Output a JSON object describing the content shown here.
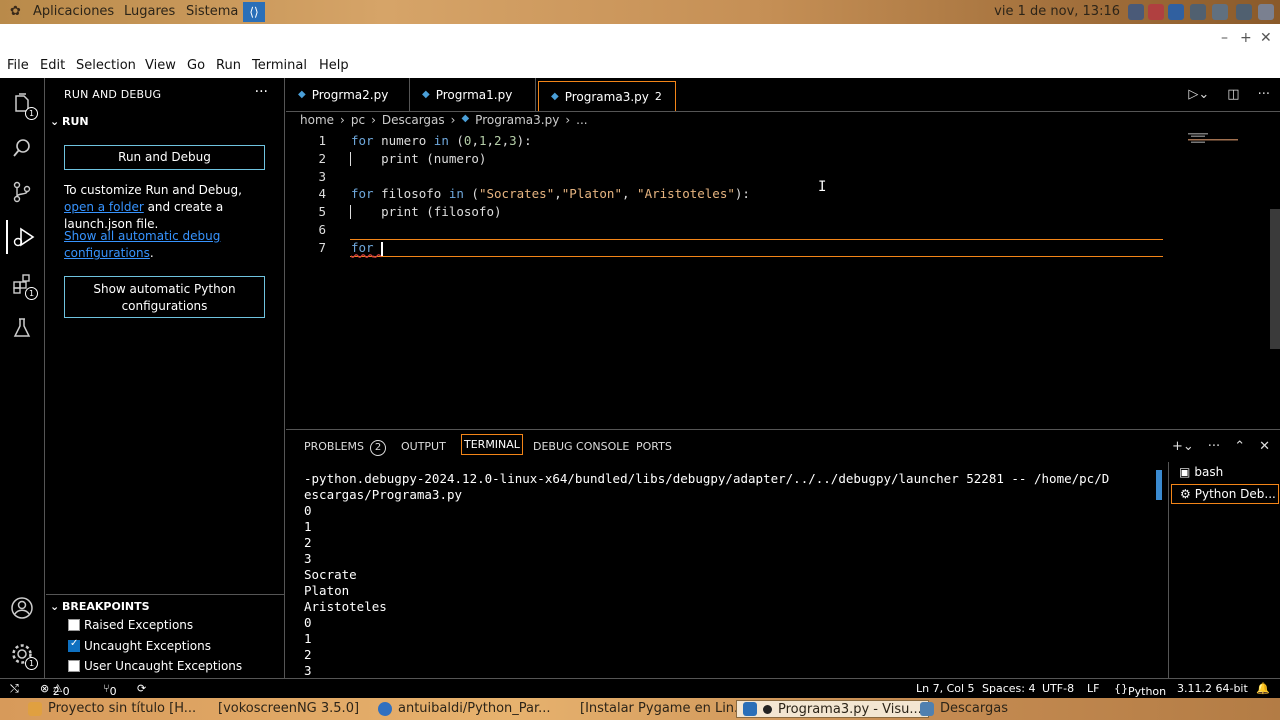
{
  "os_panel": {
    "menus": [
      "Aplicaciones",
      "Lugares",
      "Sistema"
    ],
    "clock": "vie  1 de nov, 13:16"
  },
  "menubar": [
    "File",
    "Edit",
    "Selection",
    "View",
    "Go",
    "Run",
    "Terminal",
    "Help"
  ],
  "activity_badges": {
    "explorer": "1",
    "extensions": "1",
    "settings": "1"
  },
  "sidebar": {
    "title": "RUN AND DEBUG",
    "run_section": "RUN",
    "run_button": "Run and Debug",
    "customize_text_1": "To customize Run and Debug, ",
    "customize_link": "open a folder",
    "customize_text_2": " and create a launch.json file.",
    "show_all_link": "Show all automatic debug configurations",
    "show_all_after": ".",
    "python_button": "Show automatic Python configurations",
    "breakpoints_section": "BREAKPOINTS",
    "breakpoints": [
      {
        "label": "Raised Exceptions",
        "checked": false
      },
      {
        "label": "Uncaught Exceptions",
        "checked": true
      },
      {
        "label": "User Uncaught Exceptions",
        "checked": false
      }
    ]
  },
  "tabs": [
    {
      "label": "Progrma2.py"
    },
    {
      "label": "Progrma1.py"
    },
    {
      "label": "Programa3.py",
      "badge": "2",
      "active": true
    }
  ],
  "breadcrumb": [
    "home",
    "pc",
    "Descargas",
    "Programa3.py",
    "..."
  ],
  "editor": {
    "line_numbers": [
      "1",
      "2",
      "3",
      "4",
      "5",
      "6",
      "7"
    ]
  },
  "panel": {
    "tabs": [
      "PROBLEMS",
      "OUTPUT",
      "TERMINAL",
      "DEBUG CONSOLE",
      "PORTS"
    ],
    "problems_count": "2",
    "terminal_lines": [
      "-python.debugpy-2024.12.0-linux-x64/bundled/libs/debugpy/adapter/../../debugpy/launcher 52281 -- /home/pc/D",
      "escargas/Programa3.py",
      "0",
      "1",
      "2",
      "3",
      "Socrate",
      "Platon",
      "Aristoteles",
      "0",
      "1",
      "2",
      "3"
    ],
    "terminals": [
      "bash",
      "Python Deb..."
    ]
  },
  "status": {
    "errors": "2",
    "warnings": "0",
    "ports": "0",
    "position": "Ln 7, Col 5",
    "spaces": "Spaces: 4",
    "encoding": "UTF-8",
    "eol": "LF",
    "language": "Python",
    "interpreter": "3.11.2 64-bit"
  },
  "taskbar": [
    "Proyecto sin título [H...",
    "[vokoscreenNG 3.5.0]",
    "antuibaldi/Python_Par...",
    "[Instalar Pygame en Lin...",
    "Programa3.py - Visu...",
    "Descargas"
  ]
}
